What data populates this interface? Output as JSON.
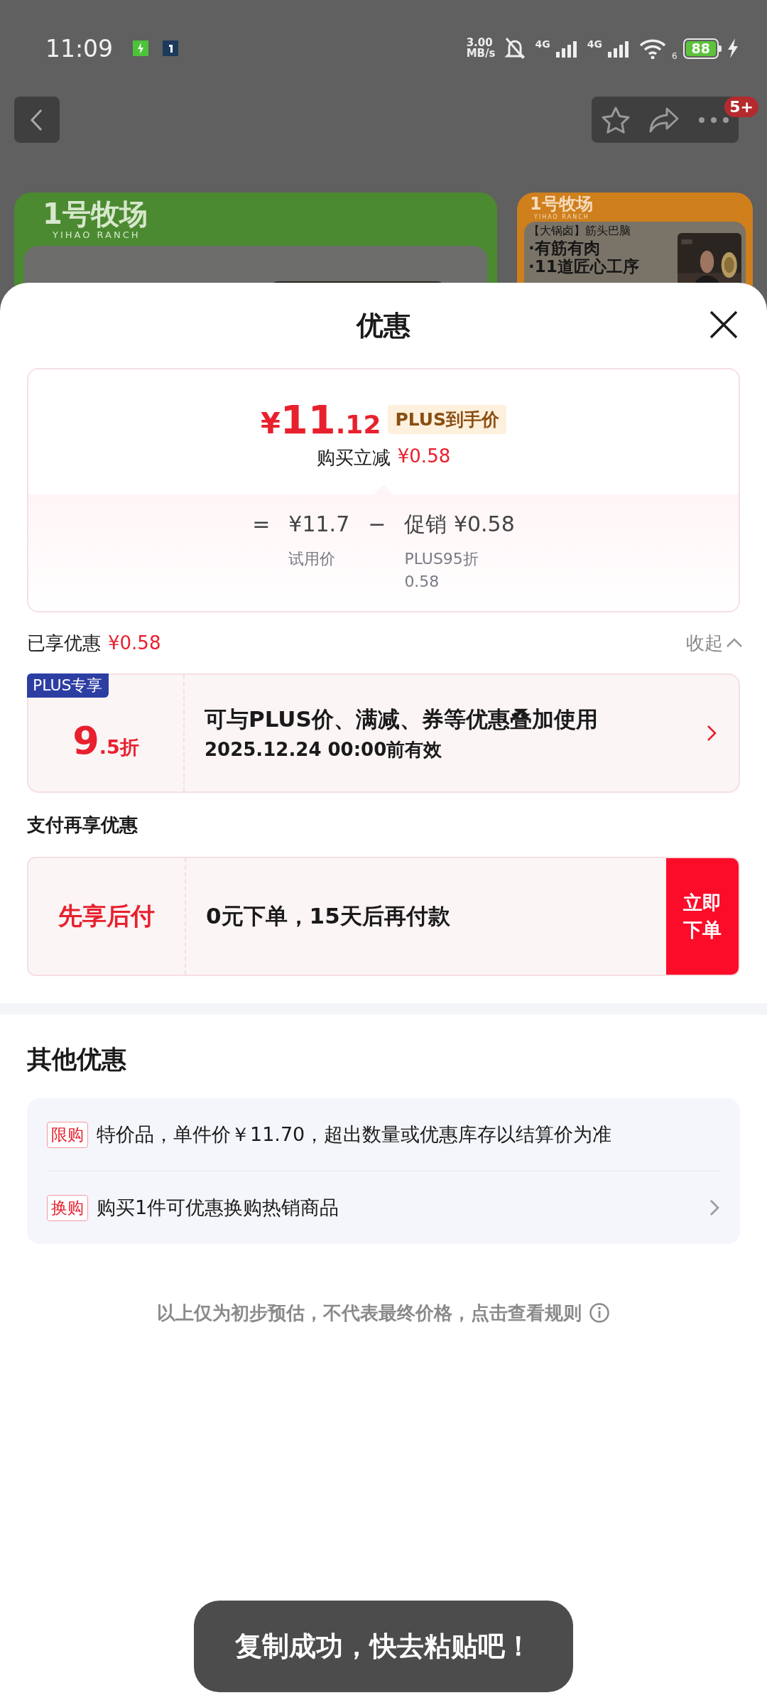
{
  "status_bar": {
    "time": "11:09",
    "speed": "3.00",
    "speed_unit": "MB/s",
    "network_1": "4G",
    "network_2": "4G",
    "wifi_sub": "6",
    "battery": "88"
  },
  "header": {
    "badge": "5+"
  },
  "banners": [
    {
      "brand": "1号牧场",
      "brand_sub": "YIHAO RANCH"
    },
    {
      "brand": "1号牧场",
      "brand_sub": "YIHAO RANCH",
      "lines": [
        "【大锅卤】筋头巴脑",
        "·有筋有肉",
        "·11道匠心工序"
      ]
    }
  ],
  "sheet": {
    "title": "优惠",
    "price": {
      "currency": "¥",
      "integer": "11",
      "decimal": ".12",
      "tag": "PLUS到手价",
      "saving_label": "购买立减",
      "saving": "¥0.58"
    },
    "breakdown": [
      {
        "kind": "operator",
        "text": "="
      },
      {
        "kind": "term",
        "value": "¥11.7",
        "notes": [
          "试用价"
        ]
      },
      {
        "kind": "operator",
        "text": "−"
      },
      {
        "kind": "term",
        "value": "促销 ¥0.58",
        "notes": [
          "PLUS95折",
          "0.58"
        ]
      }
    ],
    "enjoyed": {
      "label": "已享优惠",
      "amount": "¥0.58",
      "toggle": "收起",
      "expanded": true
    },
    "coupons": [
      {
        "tag": "PLUS专享",
        "discount_main": "9",
        "discount_sub": ".5折",
        "title": "可与PLUS价、满减、券等优惠叠加使用",
        "validity": "2025.12.24 00:00前有效"
      }
    ],
    "pay_section": {
      "heading": "支付再享优惠",
      "name": "先享后付",
      "desc": "0元下单，15天后再付款",
      "action": "立即下单"
    },
    "other": {
      "heading": "其他优惠",
      "items": [
        {
          "tag": "限购",
          "text": "特价品，单件价￥11.70，超出数量或优惠库存以结算价为准",
          "has_arrow": false
        },
        {
          "tag": "换购",
          "text": "购买1件可优惠换购热销商品",
          "has_arrow": true
        }
      ]
    },
    "note": "以上仅为初步预估，不代表最终价格，点击查看规则"
  },
  "toast": "复制成功，快去粘贴吧！"
}
